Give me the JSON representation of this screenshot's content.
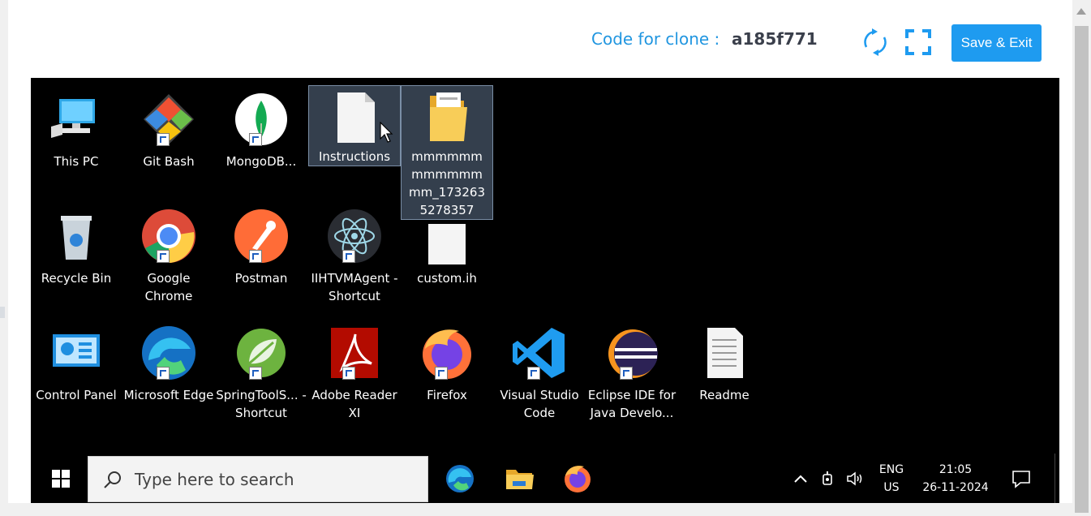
{
  "header": {
    "clone_label": "Code for clone :",
    "clone_code": "a185f771",
    "refresh_icon": "refresh-icon",
    "fullscreen_icon": "fullscreen-icon",
    "save_exit_label": "Save & Exit"
  },
  "desktop": {
    "icons": [
      {
        "label": "This PC",
        "icon": "this-pc-icon"
      },
      {
        "label": "Git Bash",
        "icon": "git-bash-icon"
      },
      {
        "label": "MongoDB...",
        "icon": "mongodb-icon"
      },
      {
        "label": "Instructions",
        "icon": "text-file-icon"
      },
      {
        "label": "mmmmmmmmmmmmmm_1732635278357",
        "icon": "folder-icon"
      },
      {
        "label": "Recycle Bin",
        "icon": "recycle-bin-icon"
      },
      {
        "label": "Google Chrome",
        "icon": "chrome-icon"
      },
      {
        "label": "Postman",
        "icon": "postman-icon"
      },
      {
        "label": "IIHTVMAgent - Shortcut",
        "icon": "atom-icon"
      },
      {
        "label": "custom.ih",
        "icon": "blank-file-icon"
      },
      {
        "label": "Control Panel",
        "icon": "control-panel-icon"
      },
      {
        "label": "Microsoft Edge",
        "icon": "edge-icon"
      },
      {
        "label": "SpringToolS... - Shortcut",
        "icon": "spring-icon"
      },
      {
        "label": "Adobe Reader XI",
        "icon": "adobe-reader-icon"
      },
      {
        "label": "Firefox",
        "icon": "firefox-icon"
      },
      {
        "label": "Visual Studio Code",
        "icon": "vscode-icon"
      },
      {
        "label": "Eclipse IDE for Java Develo...",
        "icon": "eclipse-icon"
      },
      {
        "label": "Readme",
        "icon": "document-icon"
      }
    ]
  },
  "taskbar": {
    "search_placeholder": "Type here to search",
    "language_line1": "ENG",
    "language_line2": "US",
    "time": "21:05",
    "date": "26-11-2024"
  },
  "colors": {
    "accent": "#1e9bf0",
    "clone_label": "#2196e0",
    "desktop_bg": "#000000"
  }
}
